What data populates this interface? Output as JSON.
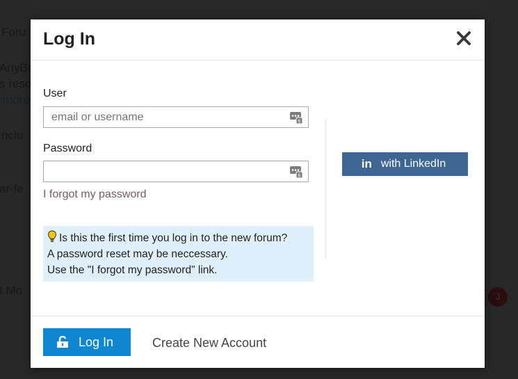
{
  "background": {
    "fragments": [
      "Foru",
      "AnyBo",
      "s reso",
      "more",
      "nclu",
      "ar-fe",
      "t Mo",
      "J"
    ]
  },
  "modal": {
    "title": "Log In",
    "close_label": "close-icon",
    "user": {
      "label": "User",
      "placeholder": "email or username",
      "value": ""
    },
    "password": {
      "label": "Password",
      "value": ""
    },
    "forgot_link": "I forgot my password",
    "notice": {
      "line1": "Is this the first time you log in to the new forum?",
      "line2": "A password reset may be neccessary.",
      "line3": "Use the \"I forgot my password\" link."
    },
    "linkedin": {
      "icon_text": "in",
      "label": "with LinkedIn"
    },
    "footer": {
      "login_label": "Log In",
      "create_account": "Create New Account"
    }
  },
  "colors": {
    "primary": "#0e87d0",
    "linkedin": "#3d6692",
    "notice_bg": "#dff0fb",
    "forgot_link": "#7a5a5a"
  },
  "icons": [
    "close-icon",
    "password-manager-icon",
    "lightbulb-icon",
    "linkedin-icon",
    "unlock-icon"
  ]
}
